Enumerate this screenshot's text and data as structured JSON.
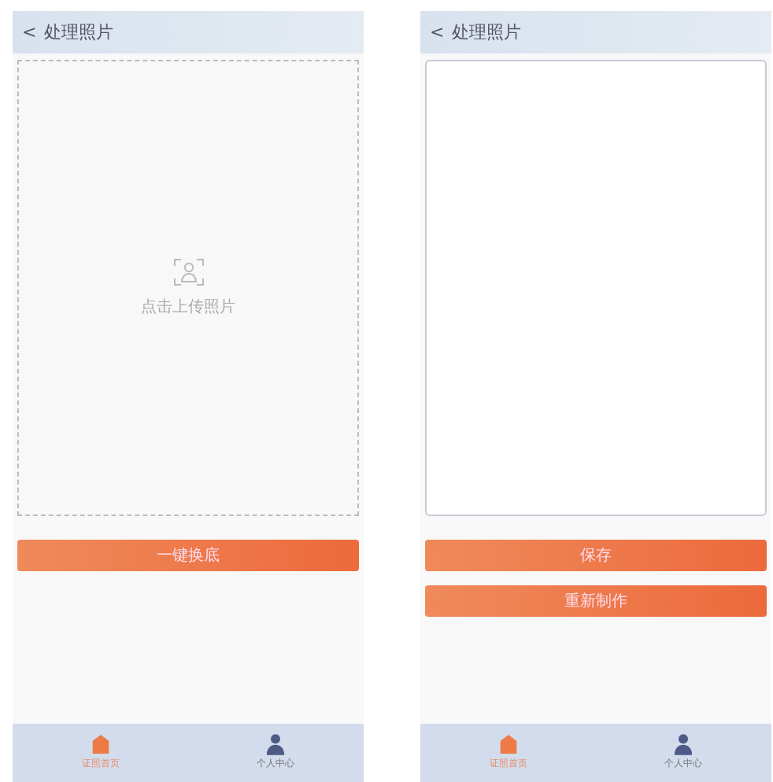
{
  "screens": [
    {
      "kind": "upload",
      "header": {
        "back": "<",
        "title": "处理照片"
      },
      "upload_label": "点击上传照片",
      "buttons": [
        "一键换底"
      ],
      "tabs": [
        {
          "label": "证照首页",
          "kind": "home",
          "selected": true
        },
        {
          "label": "个人中心",
          "kind": "person",
          "selected": false
        }
      ]
    },
    {
      "kind": "result",
      "header": {
        "back": "<",
        "title": "处理照片"
      },
      "buttons": [
        "保存",
        "重新制作"
      ],
      "tabs": [
        {
          "label": "证照首页",
          "kind": "home",
          "selected": true
        },
        {
          "label": "个人中心",
          "kind": "person",
          "selected": false
        }
      ]
    }
  ]
}
